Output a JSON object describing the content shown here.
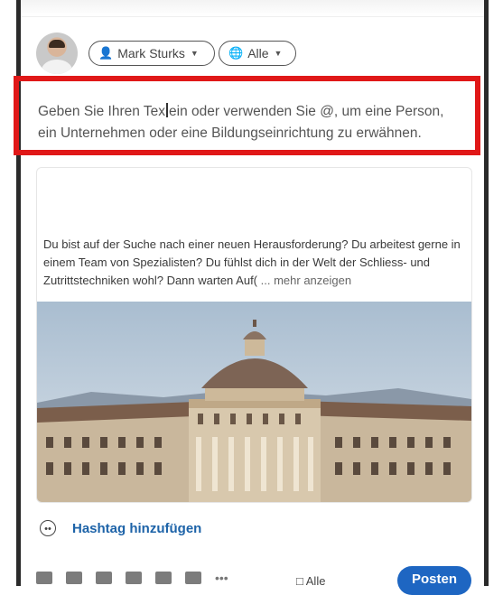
{
  "composer": {
    "author": {
      "name": "Mark Sturks",
      "icon": "user-icon",
      "caret_icon": "chevron-down-icon"
    },
    "visibility": {
      "label": "Alle",
      "icon": "globe-icon",
      "caret_icon": "chevron-down-icon"
    },
    "text_before_cursor": "Geben Sie Ihren Tex",
    "text_after_cursor": "ein oder verwenden Sie @, um eine Person, ein Unternehmen oder eine Bildungseinrichtung zu erwähnen."
  },
  "preview_card": {
    "text": "Du bist auf der Suche nach einer neuen Herausforderung? Du arbeitest gerne in einem Team von Spezialisten? Du fühlst dich in der Welt der Schliess- und Zutrittstechniken wohl? Dann warten Auf(",
    "more_label": "... mehr anzeigen",
    "image": "domed-building-photo"
  },
  "hashtag": {
    "icon": "smiley-icon",
    "label": "Hashtag hinzufügen"
  },
  "footer": {
    "tools": [
      "image-icon",
      "video-icon",
      "document-icon",
      "briefcase-icon",
      "badge-icon",
      "chart-icon",
      "more-icon"
    ],
    "visibility_label": "Alle",
    "visibility_icon": "chat-bubble-icon",
    "post_label": "Posten"
  },
  "colors": {
    "highlight": "#e01818",
    "link": "#1d63a8",
    "button": "#1e66c2"
  }
}
